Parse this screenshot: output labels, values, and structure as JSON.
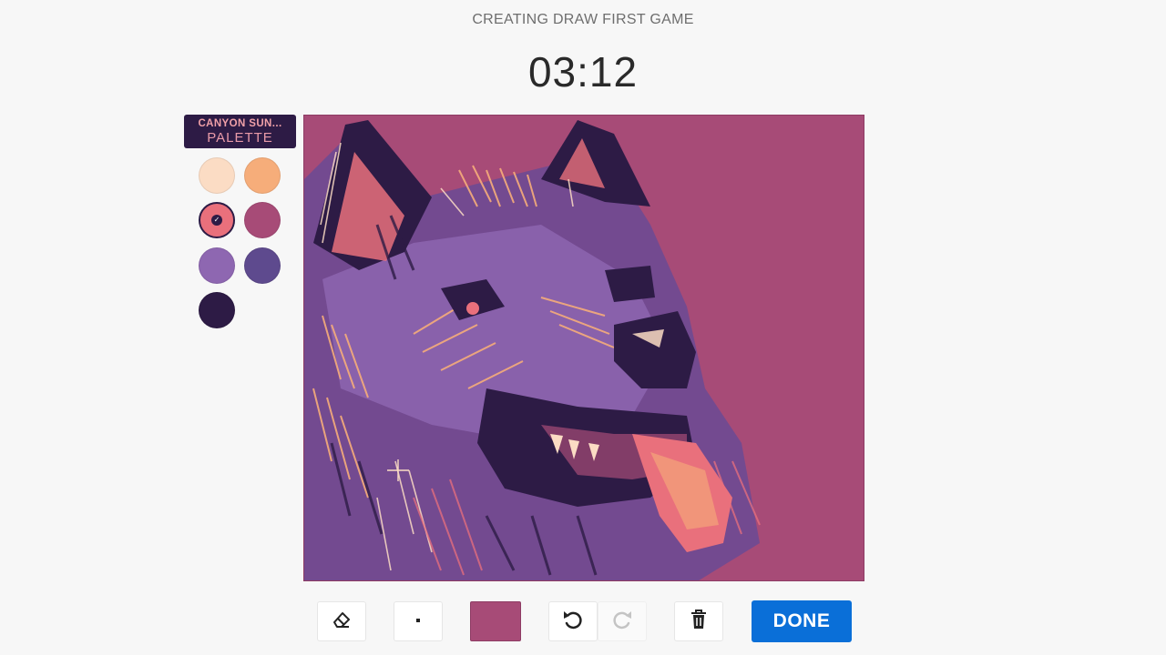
{
  "header": {
    "title": "CREATING DRAW FIRST GAME",
    "timer": "03:12"
  },
  "palette": {
    "name": "CANYON SUN...",
    "label": "PALETTE",
    "colors": [
      {
        "name": "cream",
        "hex": "#fbdcc4"
      },
      {
        "name": "peach",
        "hex": "#f6ad7a"
      },
      {
        "name": "coral",
        "hex": "#e9707c",
        "selected": true
      },
      {
        "name": "magenta",
        "hex": "#a74b77"
      },
      {
        "name": "lavender",
        "hex": "#8e67b1"
      },
      {
        "name": "purple",
        "hex": "#5e4a8e"
      },
      {
        "name": "dark-plum",
        "hex": "#2d1b45"
      }
    ]
  },
  "canvas": {
    "background": "#a74b77"
  },
  "toolbar": {
    "eraser_icon": "eraser-icon",
    "brush_size_icon": "brush-size-icon",
    "current_color": "#a74b77",
    "undo_icon": "undo-icon",
    "redo_icon": "redo-icon",
    "redo_disabled": true,
    "trash_icon": "trash-icon",
    "done_label": "DONE"
  }
}
